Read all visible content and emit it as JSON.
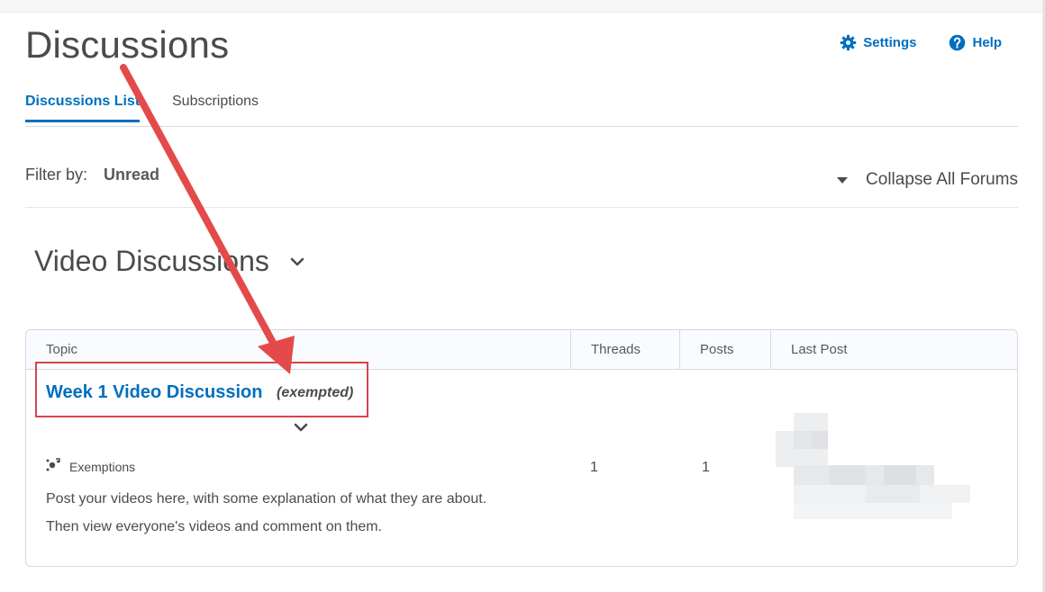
{
  "header": {
    "title": "Discussions",
    "settings_label": "Settings",
    "help_label": "Help",
    "link_color": "#006fbf"
  },
  "tabs": [
    {
      "label": "Discussions List",
      "active": true
    },
    {
      "label": "Subscriptions",
      "active": false
    }
  ],
  "filter": {
    "label": "Filter by:",
    "value": "Unread"
  },
  "collapse_label": "Collapse All Forums",
  "forum": {
    "title": "Video Discussions"
  },
  "table": {
    "columns": [
      "Topic",
      "Threads",
      "Posts",
      "Last Post"
    ],
    "rows": [
      {
        "topic": "Week 1 Video Discussion",
        "flag": "(exempted)",
        "exemptions_label": "Exemptions",
        "description": [
          "Post your videos here, with some explanation of what they are about.",
          "Then view everyone's videos and comment on them."
        ],
        "threads": "1",
        "posts": "1"
      }
    ]
  },
  "annotation": {
    "color": "#d8434a"
  },
  "icons": {
    "settings": "gear-icon",
    "help": "help-icon",
    "collapse": "caret-down-icon",
    "forum_toggle": "chevron-down-icon",
    "exemptions": "exemptions-icon"
  }
}
